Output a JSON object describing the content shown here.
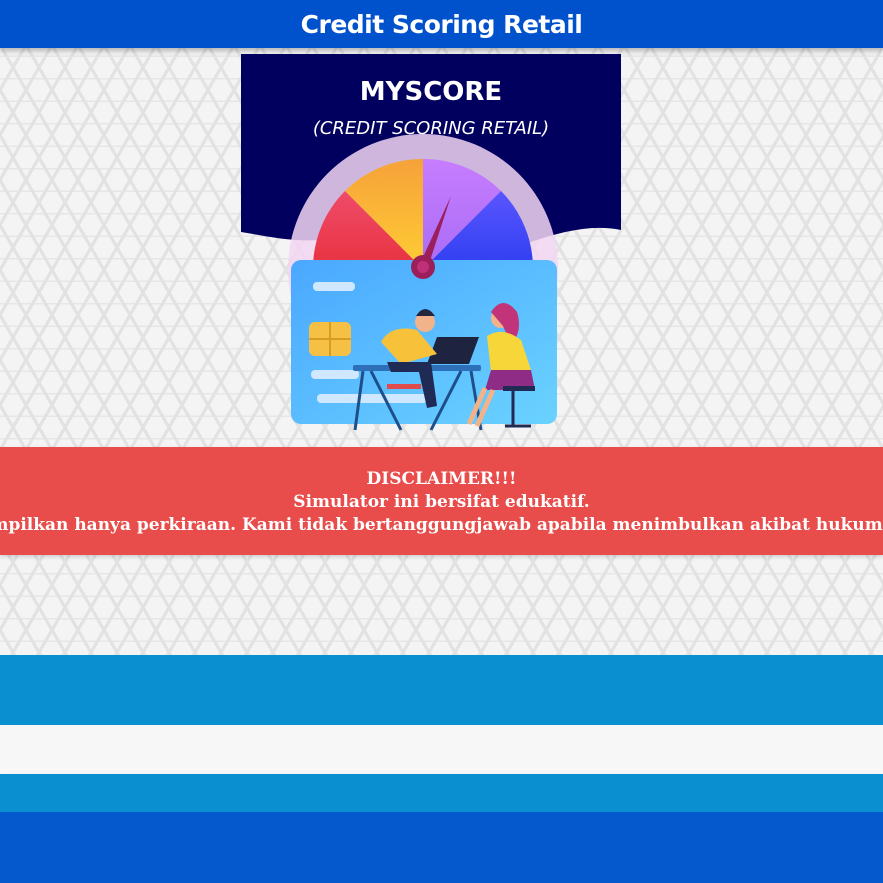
{
  "header": {
    "title": "Credit Scoring Retail"
  },
  "banner": {
    "title": "MYSCORE",
    "subtitle": "(CREDIT SCORING RETAIL)"
  },
  "disclaimer": {
    "title": "DISCLAIMER!!!",
    "line1": "Simulator ini bersifat edukatif.",
    "line2": "Hasil yang ditampilkan hanya perkiraan. Kami tidak bertanggungjawab apabila menimbulkan akibat hukum bagi pengguna."
  },
  "colors": {
    "header_bg": "#0052cc",
    "banner_bg": "#02005f",
    "disclaimer_bg": "#e84c4b",
    "band_light_blue": "#0a8fd0",
    "band_dark_blue": "#0659cc"
  }
}
